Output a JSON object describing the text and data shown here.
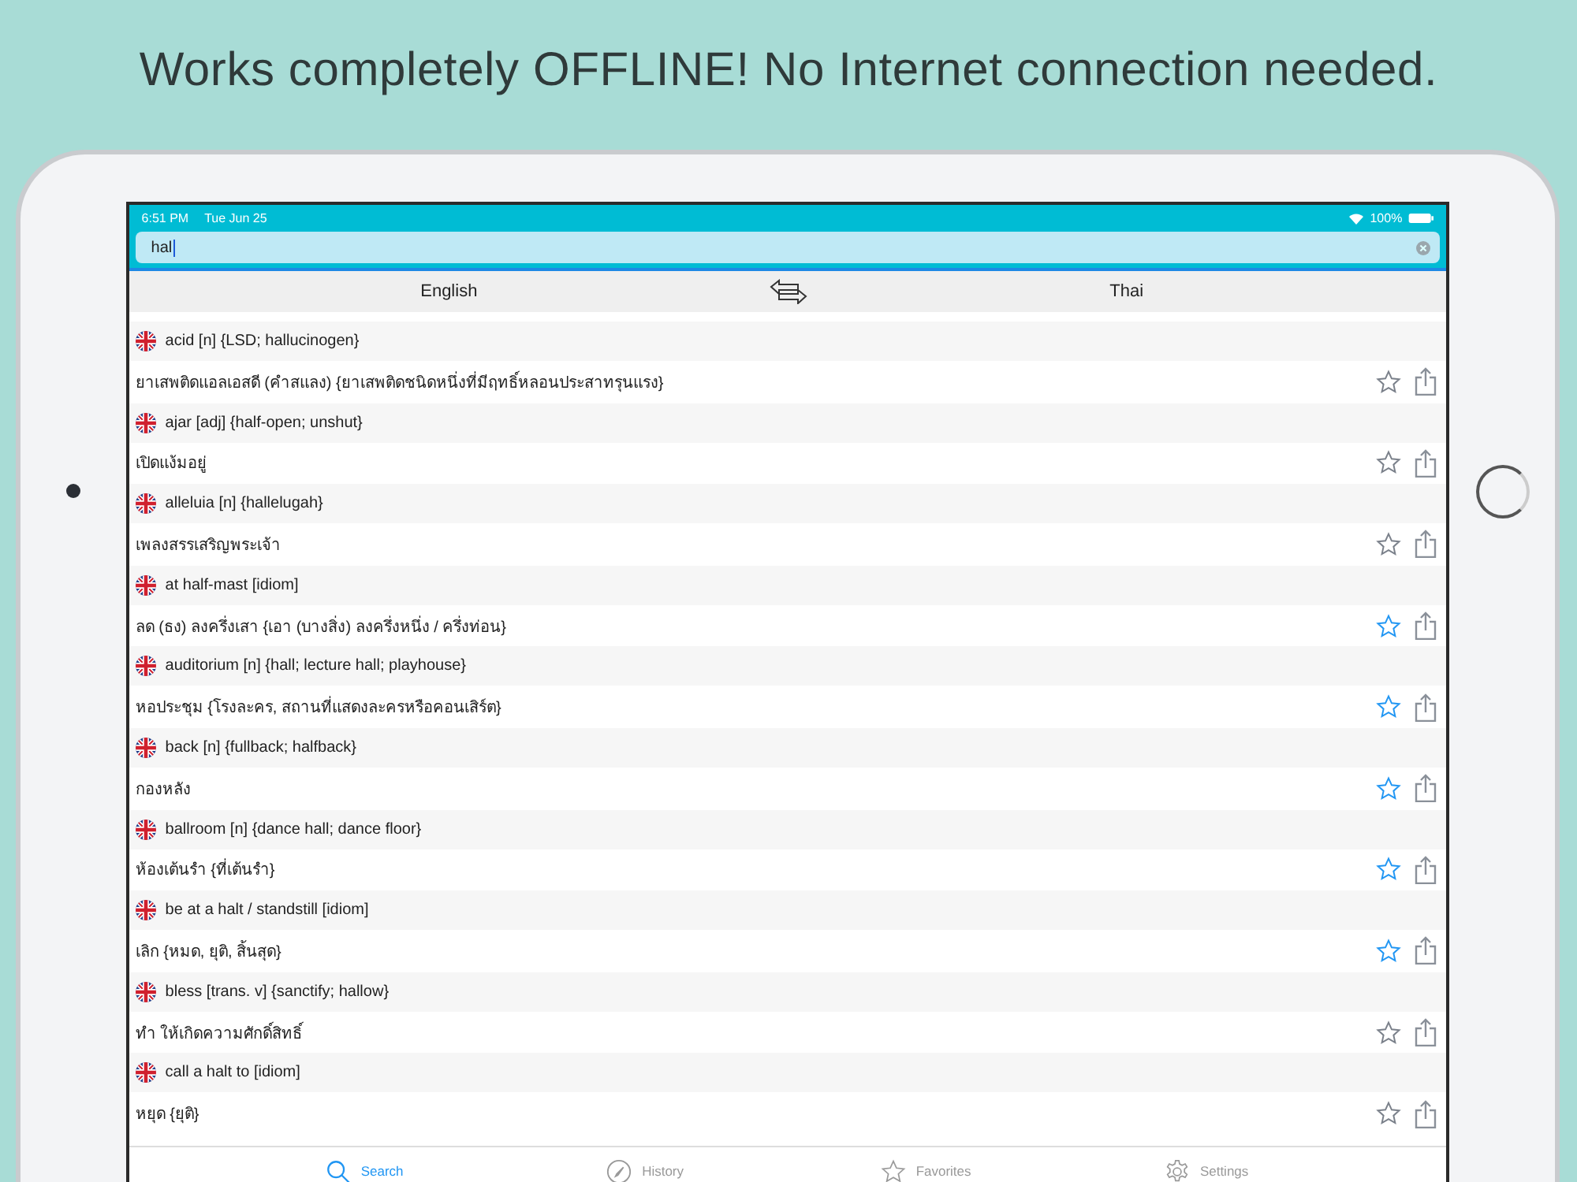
{
  "headline": "Works completely OFFLINE! No Internet connection needed.",
  "status_bar": {
    "time": "6:51 PM",
    "date": "Tue Jun 25",
    "battery": "100%"
  },
  "search": {
    "value": "hal"
  },
  "languages": {
    "source": "English",
    "target": "Thai"
  },
  "entries": [
    {
      "english": "acid [n] {LSD; hallucinogen}",
      "thai": "ยาเสพติดแอลเอสดี (คำสแลง) {ยาเสพติดชนิดหนึ่งที่มีฤทธิ์หลอนประสาทรุนแรง}",
      "favorite": false
    },
    {
      "english": "ajar [adj] {half-open; unshut}",
      "thai": "เปิดแง้มอยู่",
      "favorite": false
    },
    {
      "english": "alleluia [n] {hallelugah}",
      "thai": "เพลงสรรเสริญพระเจ้า",
      "favorite": false
    },
    {
      "english": "at half-mast [idiom]",
      "thai": "ลด (ธง) ลงครึ่งเสา {เอา (บางสิ่ง) ลงครึ่งหนึ่ง / ครึ่งท่อน}",
      "favorite": true
    },
    {
      "english": "auditorium [n] {hall; lecture hall; playhouse}",
      "thai": "หอประชุม {โรงละคร, สถานที่แสดงละครหรือคอนเสิร์ต}",
      "favorite": true
    },
    {
      "english": "back [n] {fullback; halfback}",
      "thai": "กองหลัง",
      "favorite": true
    },
    {
      "english": "ballroom [n] {dance hall; dance floor}",
      "thai": "ห้องเต้นรำ {ที่เต้นรำ}",
      "favorite": true
    },
    {
      "english": "be at a halt / standstill [idiom]",
      "thai": "เลิก {หมด, ยุติ, สิ้นสุด}",
      "favorite": true
    },
    {
      "english": "bless [trans. v] {sanctify; hallow}",
      "thai": "ทำ ให้เกิดความศักดิ์สิทธิ์",
      "favorite": false
    },
    {
      "english": "call a halt to [idiom]",
      "thai": "หยุด {ยุติ}",
      "favorite": false
    }
  ],
  "tabs": [
    {
      "kind": "search",
      "label": "Search",
      "selected": true
    },
    {
      "kind": "history",
      "label": "History",
      "selected": false
    },
    {
      "kind": "favorites",
      "label": "Favorites",
      "selected": false
    },
    {
      "kind": "settings",
      "label": "Settings",
      "selected": false
    }
  ]
}
